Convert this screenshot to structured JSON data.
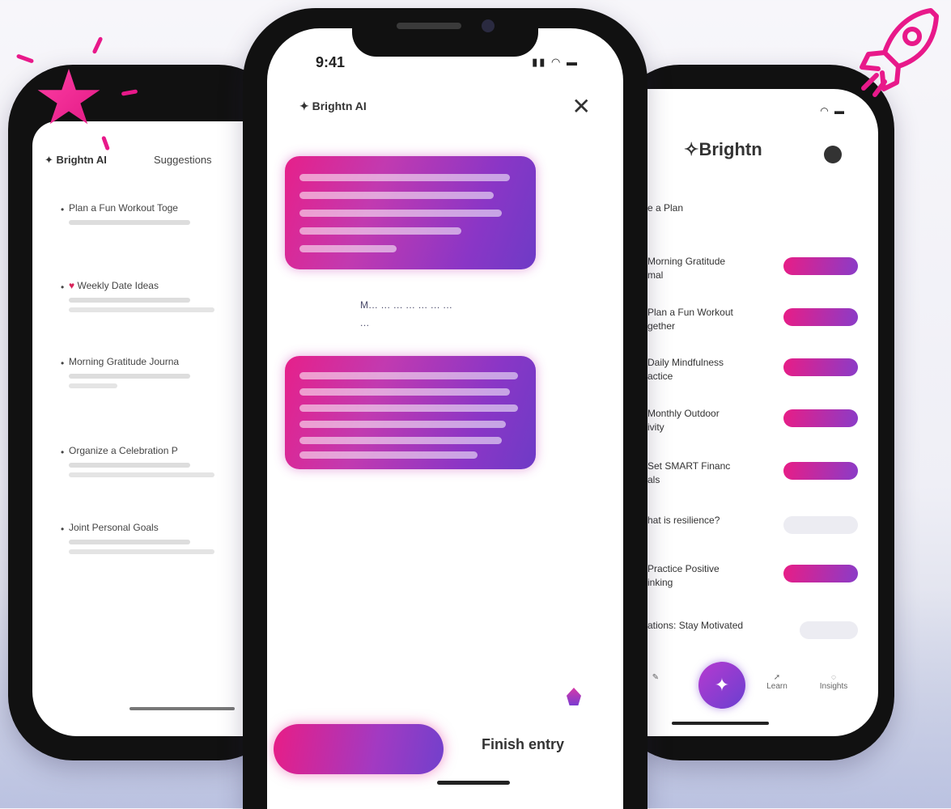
{
  "center": {
    "status_time": "9:41",
    "status_icons": "▮▮ ◠ ▬",
    "header_label": "Brightn AI",
    "close_label": "✕",
    "middle_text_line1": "M... ... ... ... ... ... ...",
    "middle_text_line2": "...",
    "cta_label": "",
    "finish_label": "Finish entry"
  },
  "left": {
    "header_label": "Brightn AI",
    "tab_label": "Suggestions",
    "items": [
      {
        "title": "Plan a Fun Workout Toge"
      },
      {
        "title": "Weekly Date Ideas"
      },
      {
        "title": "Morning Gratitude Journa"
      },
      {
        "title": "Organize a Celebration P"
      },
      {
        "title": "Joint Personal Goals"
      }
    ]
  },
  "right": {
    "brand": "Brightn",
    "section_title": "e a Plan",
    "rows": [
      {
        "title": "Morning Gratitude",
        "sub": "mal"
      },
      {
        "title": "Plan a Fun Workout",
        "sub": "gether"
      },
      {
        "title": "Daily Mindfulness",
        "sub": "actice"
      },
      {
        "title": "Monthly Outdoor",
        "sub": "ivity"
      },
      {
        "title": "Set SMART Financ",
        "sub": "als"
      },
      {
        "title": "hat is resilience?",
        "sub": ""
      },
      {
        "title": "Practice Positive",
        "sub": "inking"
      },
      {
        "title": "ations: Stay Motivated",
        "sub": ""
      }
    ],
    "nav": [
      "",
      "Learn",
      "Insights"
    ]
  }
}
